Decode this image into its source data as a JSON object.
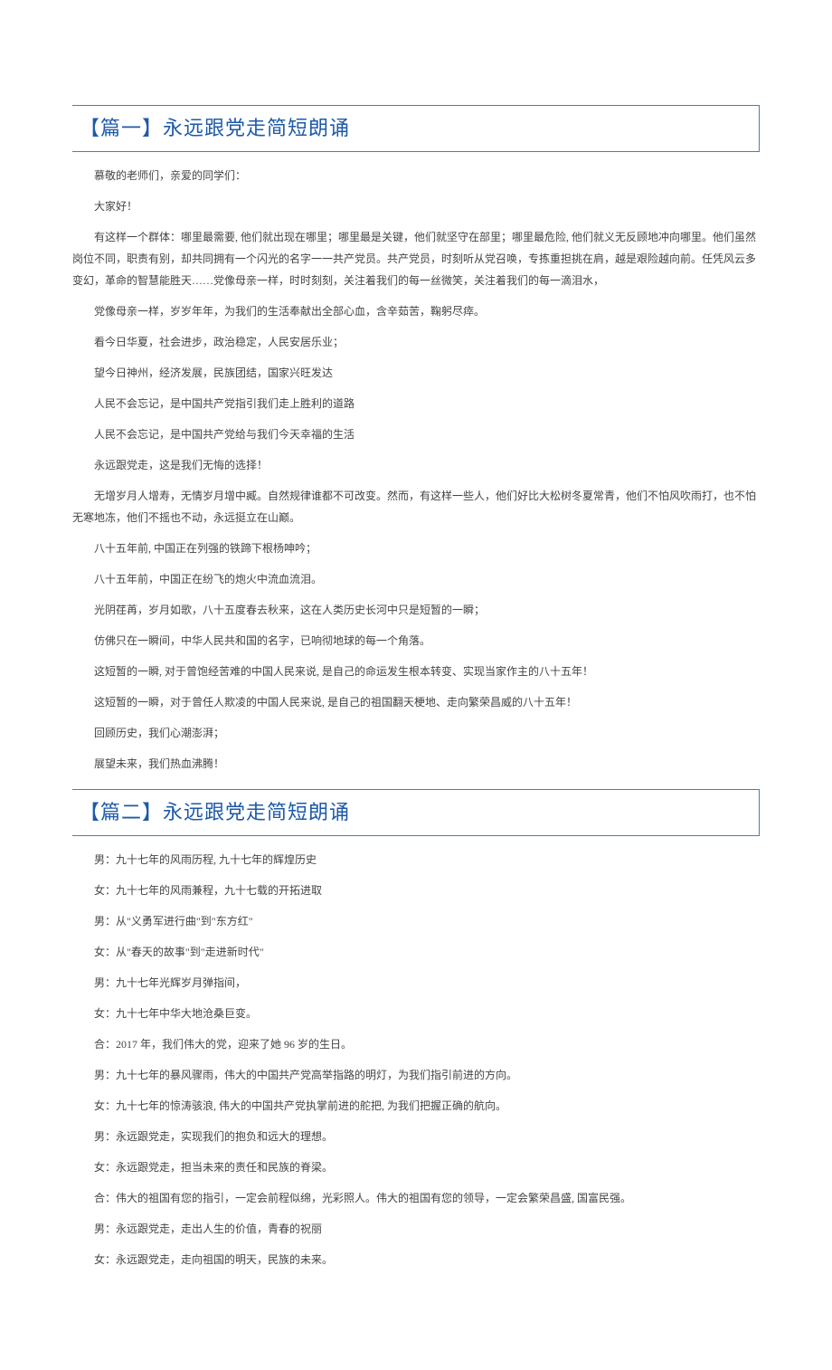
{
  "article1": {
    "heading": "【篇一】永远跟党走简短朗诵",
    "p1": "慕敬的老师们，亲爱的同学们：",
    "p2": "大家好！",
    "p3": "有这样一个群体：哪里最需要, 他们就出现在哪里；哪里最是关键，他们就坚守在部里；哪里最危险, 他们就义无反顾地冲向哪里。他们虽然岗位不同，职责有别，却共同拥有一个闪光的名字一一共产党员。共产党员，时刻听从党召唤，专拣重担挑在肩，越是艰险越向前。任凭风云多变幻，革命的智慧能胜天……党像母亲一样，时时刻刻，关注着我们的每一丝微笑，关注着我们的每一滴泪水，",
    "p4": "党像母亲一样，岁岁年年，为我们的生活奉献出全部心血，含辛茹苦，鞠躬尽瘁。",
    "p5": "看今日华夏，社会进步，政治稳定，人民安居乐业；",
    "p6": "望今日神州，经济发展，民族团结，国家兴旺发达",
    "p7": "人民不会忘记，是中国共产党指引我们走上胜利的道路",
    "p8": "人民不会忘记，是中国共产党给与我们今天幸福的生活",
    "p9": "永远跟党走，这是我们无悔的选择！",
    "p10": "无增岁月人增寿，无情岁月增中臧。自然规律谁都不可改变。然而，有这样一些人，他们好比大松树冬夏常青，他们不怕风吹雨打，也不怕无寒地冻，他们不摇也不动，永远挺立在山巅。",
    "p11": "八十五年前, 中国正在列强的铁蹄下根杨呻吟；",
    "p12": "八十五年前，中国正在纷飞的炮火中流血流泪。",
    "p13": "光阴荏苒，岁月如歌，八十五度春去秋来，这在人类历史长河中只是短暂的一瞬；",
    "p14": "仿佛只在一瞬间，中华人民共和国的名字，已响彻地球的每一个角落。",
    "p15": "这短暂的一瞬, 对于曾饱经苦难的中国人民来说, 是自己的命运发生根本转变、实现当家作主的八十五年！",
    "p16": "这短暂的一瞬，对于曾任人欺凌的中国人民来说, 是自己的祖国翻天梗地、走向繁荣昌威的八十五年！",
    "p17": "回顾历史，我们心潮澎湃；",
    "p18": "展望未来，我们热血沸腾！"
  },
  "article2": {
    "heading": "【篇二】永远跟党走简短朗诵",
    "p1": "男：九十七年的风雨历程, 九十七年的辉煌历史",
    "p2": "女：九十七年的风雨兼程，九十七载的开拓进取",
    "p3": "男：从\"义勇军进行曲\"到\"东方红\"",
    "p4": "女：从\"春天的故事\"到\"走进新时代\"",
    "p5": "男：九十七年光辉岁月弹指间，",
    "p6": "女：九十七年中华大地沧桑巨变。",
    "p7": "合：2017 年，我们伟大的党，迎来了她 96 岁的生日。",
    "p8": "男：九十七年的暴风骤雨，伟大的中国共产党高举指路的明灯，为我们指引前进的方向。",
    "p9": "女：九十七年的惊涛骇浪, 伟大的中国共产党执掌前进的舵把, 为我们把握正确的航向。",
    "p10": "男：永远跟党走，实现我们的抱负和远大的理想。",
    "p11": "女：永远跟党走，担当未来的责任和民族的脊梁。",
    "p12": "合：伟大的祖国有您的指引，一定会前程似绵，光彩照人。伟大的祖国有您的领导，一定会繁荣昌盛, 国富民强。",
    "p13": "男：永远跟党走，走出人生的价值，青春的祝丽",
    "p14": "女：永远跟党走，走向祖国的明天，民族的未来。"
  }
}
